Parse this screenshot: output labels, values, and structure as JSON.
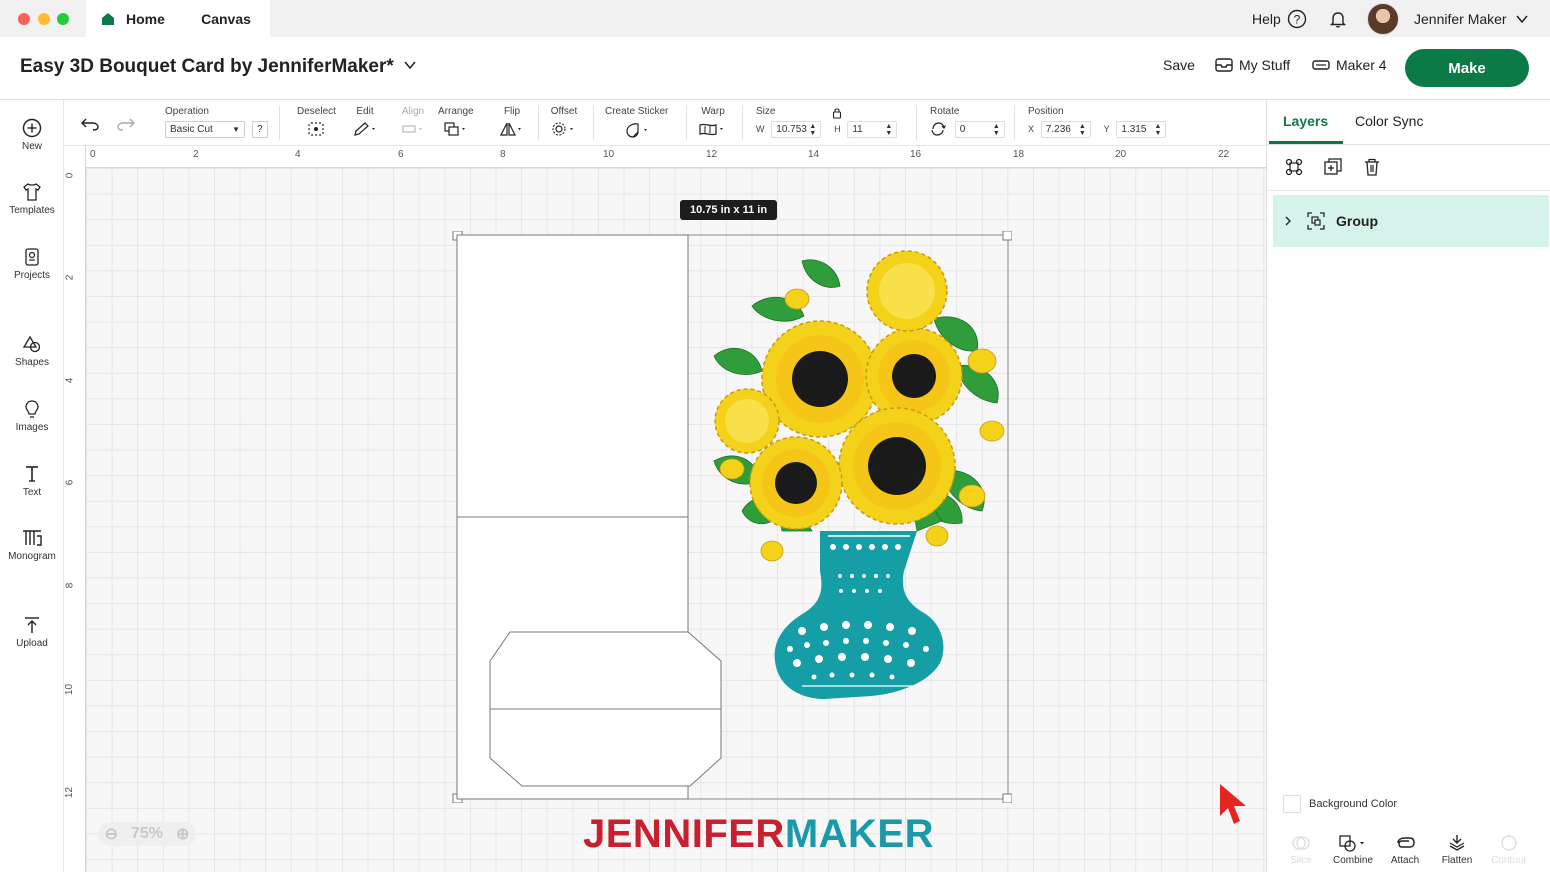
{
  "window": {
    "tabs": [
      {
        "label": "Home"
      },
      {
        "label": "Canvas"
      }
    ],
    "help_label": "Help",
    "user_name": "Jennifer Maker"
  },
  "header": {
    "project_title": "Easy 3D Bouquet Card by JenniferMaker*",
    "save_label": "Save",
    "mystuff_label": "My Stuff",
    "machine_label": "Maker 4",
    "make_label": "Make"
  },
  "sidebar": {
    "items": [
      {
        "label": "New",
        "icon": "plus-circle-icon"
      },
      {
        "label": "Templates",
        "icon": "shirt-icon"
      },
      {
        "label": "Projects",
        "icon": "projects-icon"
      },
      {
        "label": "Shapes",
        "icon": "shapes-icon"
      },
      {
        "label": "Images",
        "icon": "lightbulb-icon"
      },
      {
        "label": "Text",
        "icon": "text-icon"
      },
      {
        "label": "Monogram",
        "icon": "monogram-icon"
      },
      {
        "label": "Upload",
        "icon": "upload-icon"
      }
    ]
  },
  "toolbar": {
    "operation_label": "Operation",
    "operation_value": "Basic Cut",
    "operation_help": "?",
    "deselect_label": "Deselect",
    "edit_label": "Edit",
    "align_label": "Align",
    "arrange_label": "Arrange",
    "flip_label": "Flip",
    "offset_label": "Offset",
    "sticker_label": "Create Sticker",
    "warp_label": "Warp",
    "size_label": "Size",
    "width_prefix": "W",
    "width_value": "10.753",
    "height_prefix": "H",
    "height_value": "11",
    "rotate_label": "Rotate",
    "rotate_value": "0",
    "position_label": "Position",
    "x_prefix": "X",
    "x_value": "7.236",
    "y_prefix": "Y",
    "y_value": "1.315"
  },
  "canvas": {
    "ruler_top": [
      "0",
      "2",
      "4",
      "6",
      "8",
      "10",
      "12",
      "14",
      "16",
      "18",
      "20",
      "22"
    ],
    "ruler_left": [
      "0",
      "2",
      "4",
      "6",
      "8",
      "10",
      "12"
    ],
    "size_badge": "10.75  in x 11  in",
    "zoom_value": "75%",
    "logo_part1": "JENNIFER",
    "logo_part2": "MAKER",
    "colors": {
      "sunflower_yellow": "#f5d21a",
      "sunflower_dark": "#1a1a1a",
      "leaf_green": "#2f9e3a",
      "vase_teal": "#159ea6",
      "logo_red": "#c8202e",
      "logo_teal": "#1a9aa8",
      "make_green": "#0b7a47"
    }
  },
  "panel": {
    "tab_layers": "Layers",
    "tab_colorsync": "Color Sync",
    "group_label": "Group",
    "background_color_label": "Background Color",
    "bottom_tools": [
      {
        "label": "Slice",
        "icon": "slice-icon"
      },
      {
        "label": "Combine",
        "icon": "combine-icon"
      },
      {
        "label": "Attach",
        "icon": "attach-icon"
      },
      {
        "label": "Flatten",
        "icon": "flatten-icon"
      },
      {
        "label": "Contour",
        "icon": "contour-icon"
      }
    ]
  }
}
